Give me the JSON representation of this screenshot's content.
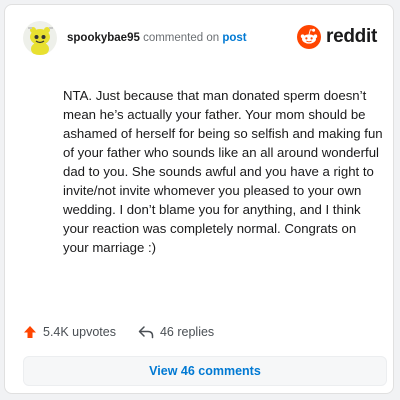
{
  "header": {
    "username": "spookybae95",
    "action_text": "commented on",
    "target_text": "post",
    "brand": "reddit"
  },
  "comment": {
    "text": "NTA. Just because that man donated sperm doesn’t mean he’s actually your father. Your mom should be ashamed of herself for being so selfish and making fun of your father who sounds like an all around wonderful dad to you. She sounds awful and you have a right to invite/not invite whomever you pleased to your own wedding. I don’t blame you for anything, and I think your reaction was completely normal. Congrats on your marriage :)"
  },
  "actions": {
    "upvotes": "5.4K upvotes",
    "replies": "46 replies"
  },
  "view_button": {
    "label": "View 46 comments"
  },
  "colors": {
    "reddit_orange": "#ff4500",
    "link_blue": "#0079d3",
    "upvote_orange": "#ff4500"
  },
  "icons": {
    "avatar": "snoo-avatar",
    "brand": "reddit-logo-icon",
    "upvote": "upvote-arrow-icon",
    "reply": "reply-arrow-icon"
  }
}
